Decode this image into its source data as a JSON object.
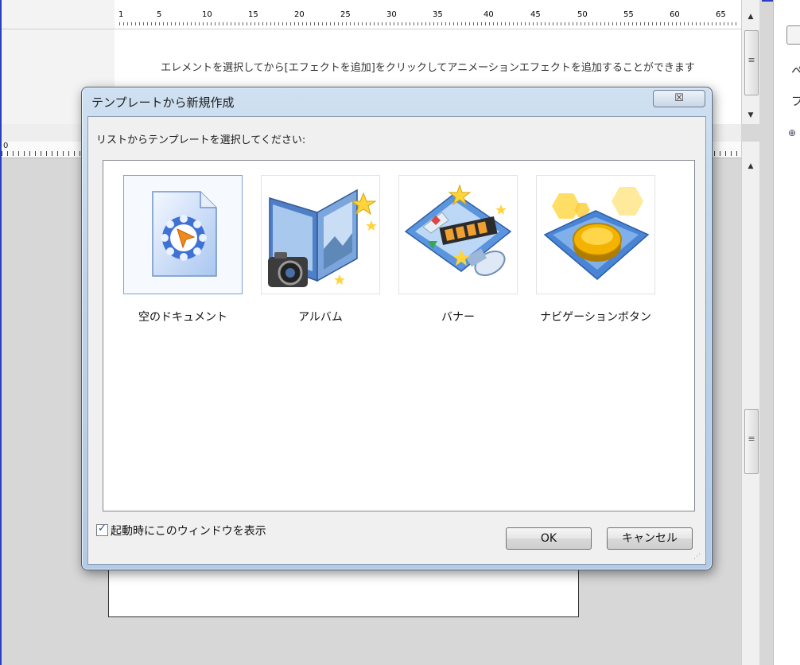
{
  "background": {
    "ruler_ticks": [
      "1",
      "5",
      "10",
      "15",
      "20",
      "25",
      "30",
      "35",
      "40",
      "45",
      "50",
      "55",
      "60",
      "65"
    ],
    "timeline_hint": "エレメントを選択してから[エフェクトを追加]をクリックしてアニメーションエフェクトを追加することができます",
    "right_panel_chars": [
      "ペ",
      "プ"
    ],
    "left_ruler_zero": "0"
  },
  "dialog": {
    "title": "テンプレートから新規作成",
    "close_glyph": "☒",
    "prompt": "リストからテンプレートを選択してください:",
    "templates": [
      {
        "label": "空のドキュメント",
        "icon": "blank-document-gear-icon",
        "selected": true
      },
      {
        "label": "アルバム",
        "icon": "album-camera-icon",
        "selected": false
      },
      {
        "label": "バナー",
        "icon": "banner-filmstrip-icon",
        "selected": false
      },
      {
        "label": "ナビゲーションボタン",
        "icon": "navigation-button-icon",
        "selected": false
      }
    ],
    "show_on_startup_label": "起動時にこのウィンドウを表示",
    "show_on_startup_checked": true,
    "ok_label": "OK",
    "cancel_label": "キャンセル"
  },
  "colors": {
    "accent_blue": "#2a3fbf",
    "dialog_frame": "#bdd3ea",
    "selection_border": "#7da2ce"
  }
}
